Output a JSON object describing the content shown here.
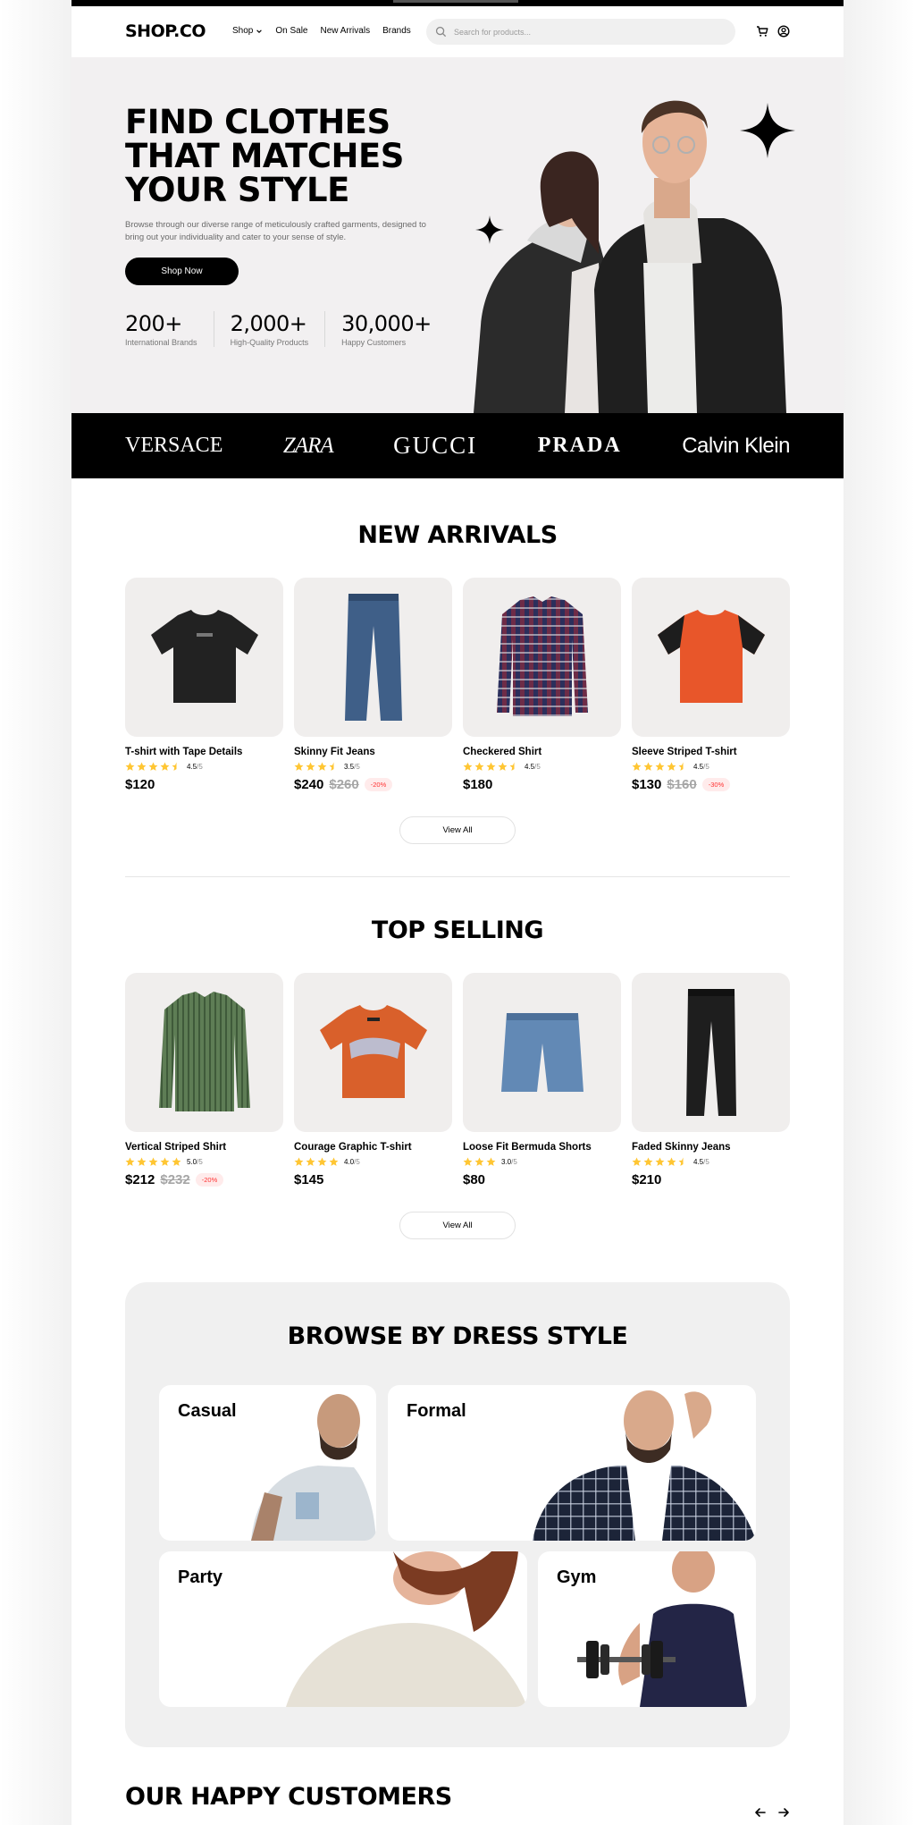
{
  "nav": {
    "logo": "SHOP.CO",
    "links": [
      "Shop",
      "On Sale",
      "New Arrivals",
      "Brands"
    ],
    "search_placeholder": "Search for products..."
  },
  "hero": {
    "title_lines": [
      "FIND CLOTHES",
      "THAT MATCHES",
      "YOUR STYLE"
    ],
    "description": "Browse through our diverse range of meticulously crafted garments, designed to bring out your individuality and cater to your sense of style.",
    "cta": "Shop Now",
    "stats": [
      {
        "value": "200+",
        "label": "International Brands"
      },
      {
        "value": "2,000+",
        "label": "High-Quality Products"
      },
      {
        "value": "30,000+",
        "label": "Happy Customers"
      }
    ]
  },
  "brands": [
    "VERSACE",
    "ZARA",
    "GUCCI",
    "PRADA",
    "Calvin Klein"
  ],
  "new_arrivals": {
    "title": "NEW ARRIVALS",
    "view_all": "View All",
    "products": [
      {
        "name": "T-shirt with Tape Details",
        "rating": 4.5,
        "rating_text": "4.5",
        "rating_max": "/5",
        "price": "$120",
        "old_price": "",
        "discount": ""
      },
      {
        "name": "Skinny Fit Jeans",
        "rating": 3.5,
        "rating_text": "3.5",
        "rating_max": "/5",
        "price": "$240",
        "old_price": "$260",
        "discount": "-20%"
      },
      {
        "name": "Checkered Shirt",
        "rating": 4.5,
        "rating_text": "4.5",
        "rating_max": "/5",
        "price": "$180",
        "old_price": "",
        "discount": ""
      },
      {
        "name": "Sleeve Striped T-shirt",
        "rating": 4.5,
        "rating_text": "4.5",
        "rating_max": "/5",
        "price": "$130",
        "old_price": "$160",
        "discount": "-30%"
      }
    ]
  },
  "top_selling": {
    "title": "TOP SELLING",
    "view_all": "View All",
    "products": [
      {
        "name": "Vertical Striped Shirt",
        "rating": 5.0,
        "rating_text": "5.0",
        "rating_max": "/5",
        "price": "$212",
        "old_price": "$232",
        "discount": "-20%"
      },
      {
        "name": "Courage Graphic T-shirt",
        "rating": 4.0,
        "rating_text": "4.0",
        "rating_max": "/5",
        "price": "$145",
        "old_price": "",
        "discount": ""
      },
      {
        "name": "Loose Fit Bermuda Shorts",
        "rating": 3.0,
        "rating_text": "3.0",
        "rating_max": "/5",
        "price": "$80",
        "old_price": "",
        "discount": ""
      },
      {
        "name": "Faded Skinny Jeans",
        "rating": 4.5,
        "rating_text": "4.5",
        "rating_max": "/5",
        "price": "$210",
        "old_price": "",
        "discount": ""
      }
    ]
  },
  "dress_style": {
    "title": "BROWSE BY DRESS STYLE",
    "styles": [
      "Casual",
      "Formal",
      "Party",
      "Gym"
    ]
  },
  "customers": {
    "title": "OUR HAPPY CUSTOMERS"
  },
  "icons": [
    "chevron-down-icon",
    "search-icon",
    "cart-icon",
    "user-icon",
    "sparkle-icon",
    "star-icon",
    "arrow-left-icon",
    "arrow-right-icon"
  ],
  "colors": {
    "accent": "#000000",
    "star": "#FFC633",
    "discount": "#FF3333",
    "hero_bg": "#F2F0F1",
    "card_bg": "#F0EEED"
  }
}
